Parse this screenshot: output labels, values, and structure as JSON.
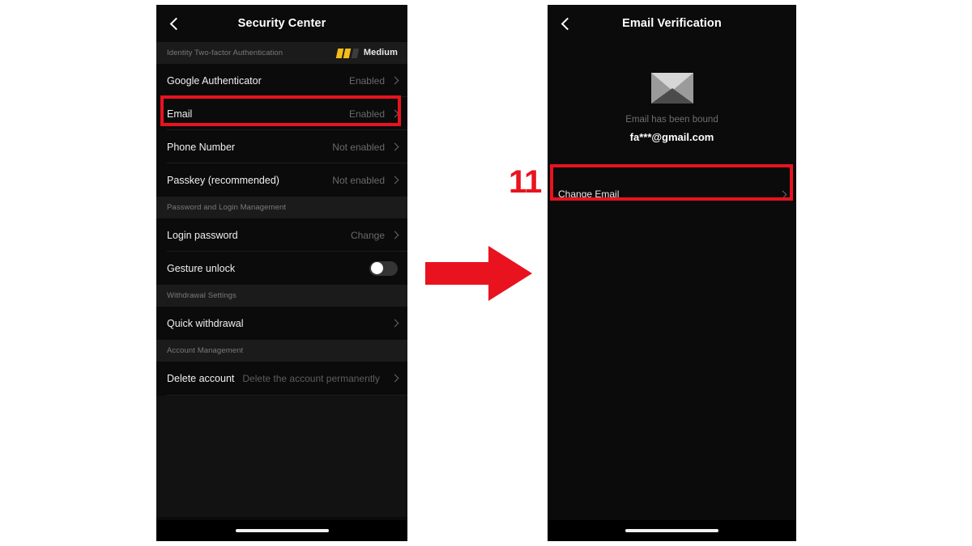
{
  "annotations": {
    "step_number": "11",
    "highlight_color": "#e8131f",
    "arrow_color": "#e8131f",
    "arrow_direction": "right"
  },
  "left_screen": {
    "nav": {
      "back_icon": "chevron-left-icon",
      "title": "Security Center"
    },
    "twofa_section": {
      "label": "Identity Two-factor Authentication",
      "strength_label": "Medium",
      "strength_filled": 2,
      "strength_total": 3,
      "strength_color": "#f5bd18",
      "strength_empty_color": "#3c3c3c"
    },
    "twofa_rows": [
      {
        "label": "Google Authenticator",
        "value": "Enabled",
        "chevron": "chevron-right-icon"
      },
      {
        "label": "Email",
        "value": "Enabled",
        "chevron": "chevron-right-icon"
      },
      {
        "label": "Phone Number",
        "value": "Not enabled",
        "chevron": "chevron-right-icon"
      },
      {
        "label": "Passkey (recommended)",
        "value": "Not enabled",
        "chevron": "chevron-right-icon"
      }
    ],
    "password_section": {
      "label": "Password and Login Management"
    },
    "password_rows": [
      {
        "label": "Login password",
        "value": "Change",
        "chevron": "chevron-right-icon"
      }
    ],
    "gesture_row": {
      "label": "Gesture unlock",
      "toggle_state": "off"
    },
    "withdrawal_section": {
      "label": "Withdrawal Settings"
    },
    "withdrawal_rows": [
      {
        "label": "Quick withdrawal",
        "value": "",
        "chevron": "chevron-right-icon"
      }
    ],
    "account_section": {
      "label": "Account Management"
    },
    "account_rows": [
      {
        "label": "Delete account",
        "sub": "Delete the account permanently",
        "chevron": "chevron-right-icon"
      }
    ],
    "home_indicator": "home-indicator"
  },
  "right_screen": {
    "nav": {
      "back_icon": "chevron-left-icon",
      "title": "Email Verification"
    },
    "envelope_icon": "envelope-icon",
    "bound_text": "Email has been bound",
    "bound_email": "fa***@gmail.com",
    "change_row": {
      "label": "Change Email",
      "chevron": "chevron-right-icon"
    },
    "home_indicator": "home-indicator"
  }
}
